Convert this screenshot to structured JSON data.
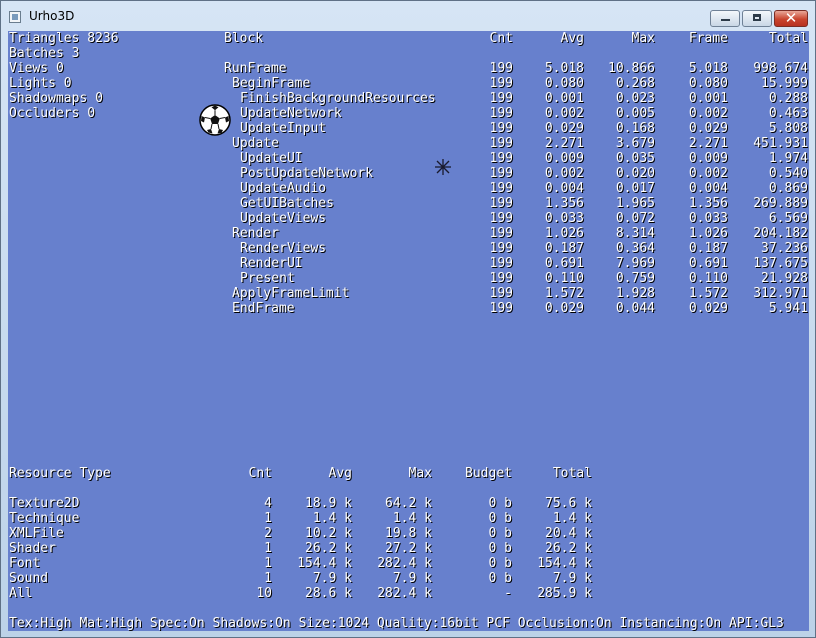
{
  "window": {
    "title": "Urho3D",
    "min_glyph": "",
    "max_glyph": "",
    "close_glyph": "✕"
  },
  "stats": [
    "Triangles 8236",
    "Batches 3",
    "Views 0",
    "Lights 0",
    "Shadowmaps 0",
    "Occluders 0"
  ],
  "profiler": {
    "headers": [
      "Block",
      "Cnt",
      "Avg",
      "Max",
      "Frame",
      "Total"
    ],
    "rows": [
      {
        "block": "RunFrame",
        "depth": 0,
        "cnt": "199",
        "avg": "5.018",
        "max": "10.866",
        "frame": "5.018",
        "total": "998.674"
      },
      {
        "block": "BeginFrame",
        "depth": 1,
        "cnt": "199",
        "avg": "0.080",
        "max": "0.268",
        "frame": "0.080",
        "total": "15.999"
      },
      {
        "block": "FinishBackgroundResources",
        "depth": 2,
        "cnt": "199",
        "avg": "0.001",
        "max": "0.023",
        "frame": "0.001",
        "total": "0.288"
      },
      {
        "block": "UpdateNetwork",
        "depth": 2,
        "cnt": "199",
        "avg": "0.002",
        "max": "0.005",
        "frame": "0.002",
        "total": "0.463"
      },
      {
        "block": "UpdateInput",
        "depth": 2,
        "cnt": "199",
        "avg": "0.029",
        "max": "0.168",
        "frame": "0.029",
        "total": "5.808"
      },
      {
        "block": "Update",
        "depth": 1,
        "cnt": "199",
        "avg": "2.271",
        "max": "3.679",
        "frame": "2.271",
        "total": "451.931"
      },
      {
        "block": "UpdateUI",
        "depth": 2,
        "cnt": "199",
        "avg": "0.009",
        "max": "0.035",
        "frame": "0.009",
        "total": "1.974"
      },
      {
        "block": "PostUpdateNetwork",
        "depth": 2,
        "cnt": "199",
        "avg": "0.002",
        "max": "0.020",
        "frame": "0.002",
        "total": "0.540"
      },
      {
        "block": "UpdateAudio",
        "depth": 2,
        "cnt": "199",
        "avg": "0.004",
        "max": "0.017",
        "frame": "0.004",
        "total": "0.869"
      },
      {
        "block": "GetUIBatches",
        "depth": 2,
        "cnt": "199",
        "avg": "1.356",
        "max": "1.965",
        "frame": "1.356",
        "total": "269.889"
      },
      {
        "block": "UpdateViews",
        "depth": 2,
        "cnt": "199",
        "avg": "0.033",
        "max": "0.072",
        "frame": "0.033",
        "total": "6.569"
      },
      {
        "block": "Render",
        "depth": 1,
        "cnt": "199",
        "avg": "1.026",
        "max": "8.314",
        "frame": "1.026",
        "total": "204.182"
      },
      {
        "block": "RenderViews",
        "depth": 2,
        "cnt": "199",
        "avg": "0.187",
        "max": "0.364",
        "frame": "0.187",
        "total": "37.236"
      },
      {
        "block": "RenderUI",
        "depth": 2,
        "cnt": "199",
        "avg": "0.691",
        "max": "7.969",
        "frame": "0.691",
        "total": "137.675"
      },
      {
        "block": "Present",
        "depth": 2,
        "cnt": "199",
        "avg": "0.110",
        "max": "0.759",
        "frame": "0.110",
        "total": "21.928"
      },
      {
        "block": "ApplyFrameLimit",
        "depth": 1,
        "cnt": "199",
        "avg": "1.572",
        "max": "1.928",
        "frame": "1.572",
        "total": "312.971"
      },
      {
        "block": "EndFrame",
        "depth": 1,
        "cnt": "199",
        "avg": "0.029",
        "max": "0.044",
        "frame": "0.029",
        "total": "5.941"
      }
    ]
  },
  "resources": {
    "headers": [
      "Resource Type",
      "Cnt",
      "Avg",
      "Max",
      "Budget",
      "Total"
    ],
    "rows": [
      {
        "type": "Texture2D",
        "cnt": "4",
        "avg": "18.9 k",
        "max": "64.2 k",
        "budget": "0 b",
        "total": "75.6 k"
      },
      {
        "type": "Technique",
        "cnt": "1",
        "avg": "1.4 k",
        "max": "1.4 k",
        "budget": "0 b",
        "total": "1.4 k"
      },
      {
        "type": "XMLFile",
        "cnt": "2",
        "avg": "10.2 k",
        "max": "19.8 k",
        "budget": "0 b",
        "total": "20.4 k"
      },
      {
        "type": "Shader",
        "cnt": "1",
        "avg": "26.2 k",
        "max": "27.2 k",
        "budget": "0 b",
        "total": "26.2 k"
      },
      {
        "type": "Font",
        "cnt": "1",
        "avg": "154.4 k",
        "max": "282.4 k",
        "budget": "0 b",
        "total": "154.4 k"
      },
      {
        "type": "Sound",
        "cnt": "1",
        "avg": "7.9 k",
        "max": "7.9 k",
        "budget": "0 b",
        "total": "7.9 k"
      },
      {
        "type": "All",
        "cnt": "10",
        "avg": "28.6 k",
        "max": "282.4 k",
        "budget": "-",
        "total": "285.9 k"
      }
    ]
  },
  "status_line": "Tex:High Mat:High Spec:On Shadows:On Size:1024 Quality:16bit PCF Occlusion:On Instancing:On API:GL3",
  "sprites": {
    "ball": "soccer-ball",
    "cursor": "star-cursor"
  },
  "colors": {
    "viewport_bg": "#6780cd",
    "text": "#ffffff",
    "text_shadow": "#000000"
  }
}
